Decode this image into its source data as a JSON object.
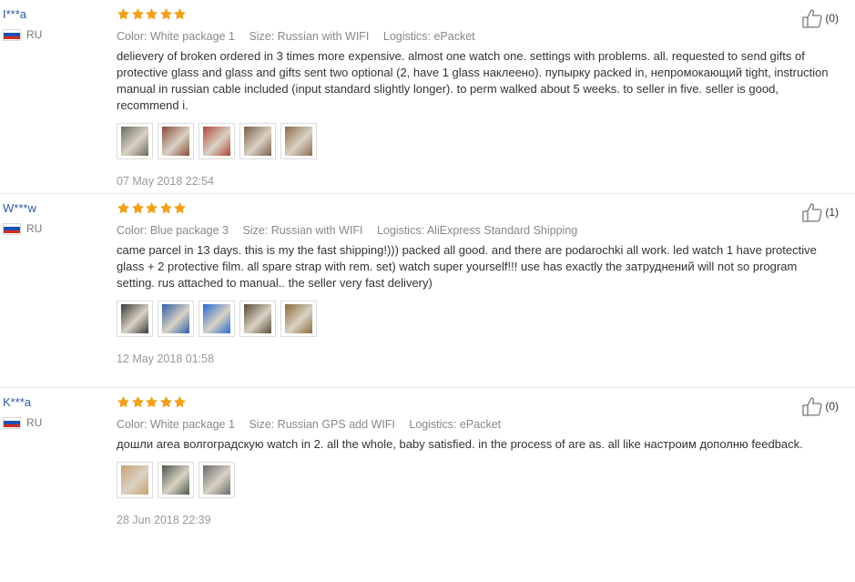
{
  "reviews": [
    {
      "user": "I***a",
      "country": "RU",
      "rating": 5,
      "color": "Color: White package 1",
      "ships_from": "Size: Russian with WIFI",
      "logistics": "Logistics: ePacket",
      "text": "delievery of broken ordered in 3 times more expensive. almost one watch one. settings with problems. all. requested to send gifts of protective glass and glass and gifts sent two optional (2, have 1 glass наклеено). пупырку packed in, непромокающий tight, instruction manual in russian cable included (input standard slightly longer). to perm walked about 5 weeks. to seller in five. seller is good, recommend i.",
      "date": "07 May 2018 22:54",
      "helpful": "(0)",
      "photos": [
        "#6b6b5a",
        "#8a4a3a",
        "#b0473a",
        "#7a5f4a",
        "#8b6b4b"
      ]
    },
    {
      "user": "W***w",
      "country": "RU",
      "rating": 5,
      "color": "Color: Blue package 3",
      "ships_from": "Size: Russian with WIFI",
      "logistics": "Logistics: AliExpress Standard Shipping",
      "text": "came parcel in 13 days. this is my the fast shipping!))) packed all good. and there are podarochki all work. led watch 1 have protective glass + 2 protective film. all spare strap with rem. set) watch super yourself!!! use has exactly the затруднений will not so program setting. rus attached to manual.. the seller very fast delivery)",
      "date": "12 May 2018 01:58",
      "helpful": "(1)",
      "photos": [
        "#3a3a3a",
        "#2e5fa8",
        "#2a6ad0",
        "#5a4a3a",
        "#8a6a3a"
      ]
    },
    {
      "user": "K***a",
      "country": "RU",
      "rating": 5,
      "color": "Color: White package 1",
      "ships_from": "Size: Russian GPS add WIFI",
      "logistics": "Logistics: ePacket",
      "text": "дошли area волгоградскую watch in 2. all the whole, baby satisfied. in the process of are as. all like настроим дополню feedback.",
      "date": "28 Jun 2018 22:39",
      "helpful": "(0)",
      "photos": [
        "#c8a070",
        "#4a5a4a",
        "#6a6a6a"
      ]
    }
  ],
  "colors": {
    "star": "#f0a01b",
    "user_link": "#2c5aa0",
    "flag": [
      "#ffffff",
      "#1e50b4",
      "#d52b1e"
    ]
  },
  "icons": {
    "helpful": "thumbs-up-icon",
    "rating": "star-icon",
    "country": "russia-flag-icon"
  }
}
